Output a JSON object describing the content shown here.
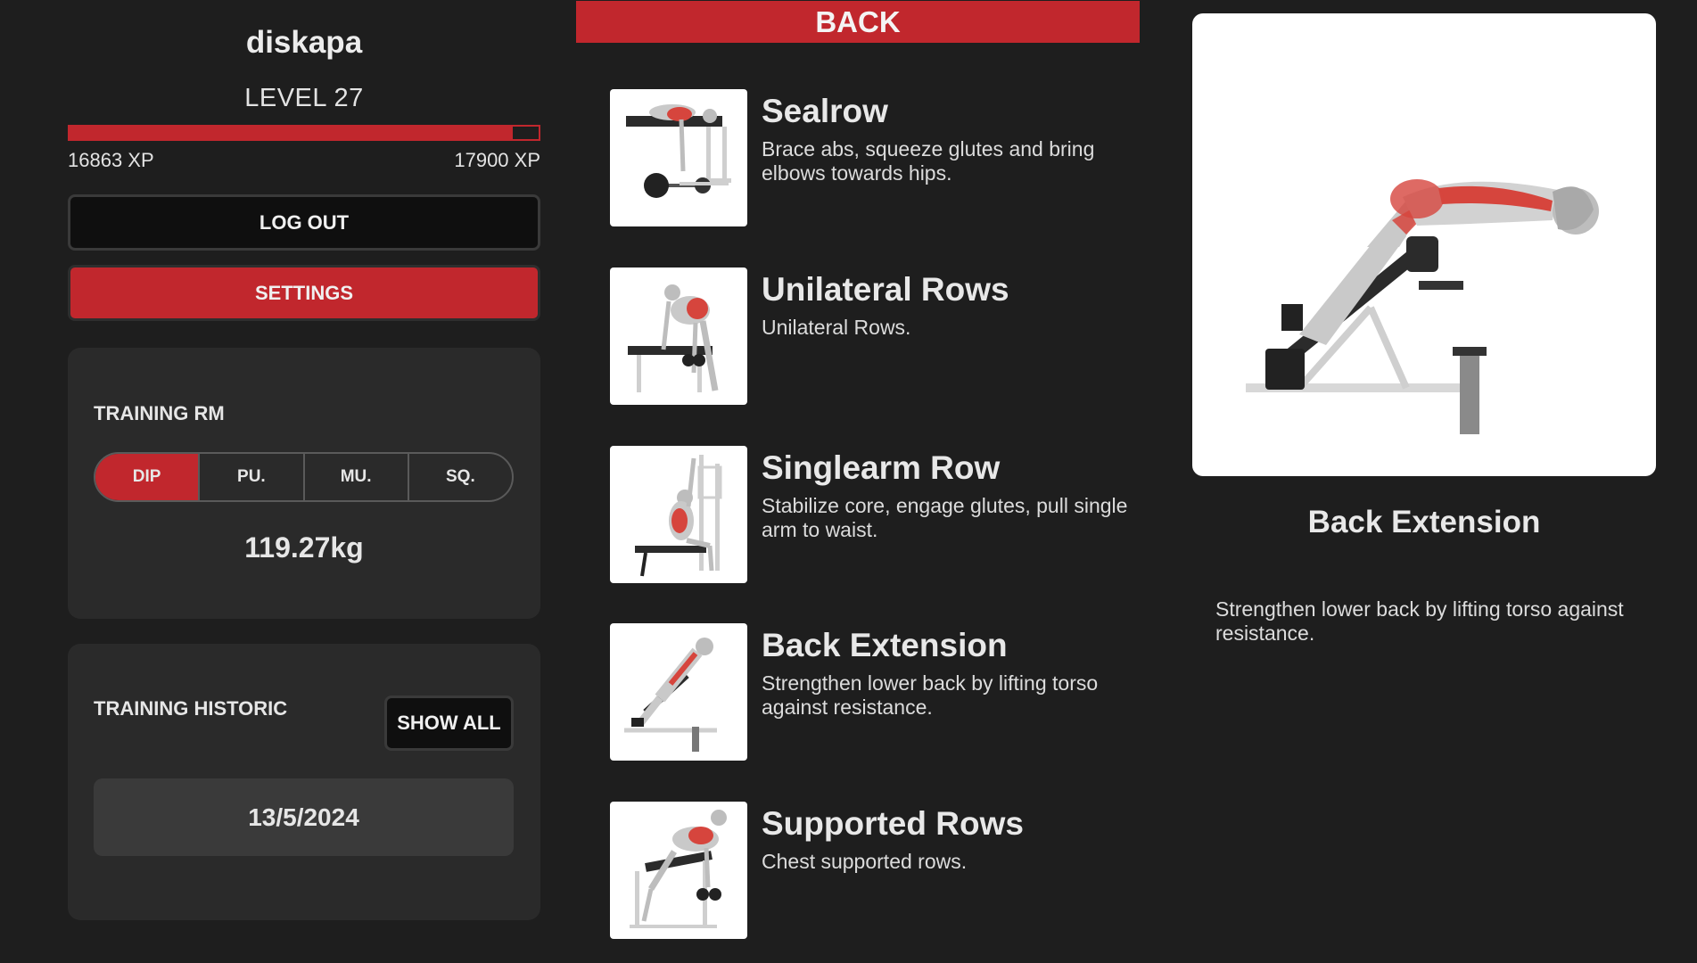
{
  "profile": {
    "username": "diskapa",
    "level_label": "LEVEL 27",
    "xp_current": "16863 XP",
    "xp_next": "17900 XP",
    "xp_progress": 0.944,
    "logout_label": "LOG OUT",
    "settings_label": "SETTINGS"
  },
  "training_rm": {
    "title": "TRAINING RM",
    "tabs": [
      {
        "label": "DIP",
        "active": true
      },
      {
        "label": "PU.",
        "active": false
      },
      {
        "label": "MU.",
        "active": false
      },
      {
        "label": "SQ.",
        "active": false
      }
    ],
    "value": "119.27kg"
  },
  "training_historic": {
    "title": "TRAINING HISTORIC",
    "show_all_label": "SHOW ALL",
    "entries": [
      "13/5/2024"
    ]
  },
  "category": {
    "title": "BACK",
    "exercises": [
      {
        "name": "Sealrow",
        "description": "Brace abs, squeeze glutes and bring elbows towards hips.",
        "icon": "sealrow-illustration"
      },
      {
        "name": "Unilateral Rows",
        "description": "Unilateral Rows.",
        "icon": "unilateral-row-illustration"
      },
      {
        "name": "Singlearm Row",
        "description": "Stabilize core, engage glutes, pull single arm to waist.",
        "icon": "singlearm-row-illustration"
      },
      {
        "name": "Back Extension",
        "description": "Strengthen lower back by lifting torso against resistance.",
        "icon": "back-extension-illustration"
      },
      {
        "name": "Supported Rows",
        "description": "Chest supported rows.",
        "icon": "supported-row-illustration"
      }
    ]
  },
  "detail": {
    "name": "Back Extension",
    "description": "Strengthen lower back by lifting torso against resistance.",
    "icon": "back-extension-illustration"
  },
  "colors": {
    "accent": "#c1272d",
    "background": "#1e1e1e",
    "card": "#2a2a2a"
  }
}
